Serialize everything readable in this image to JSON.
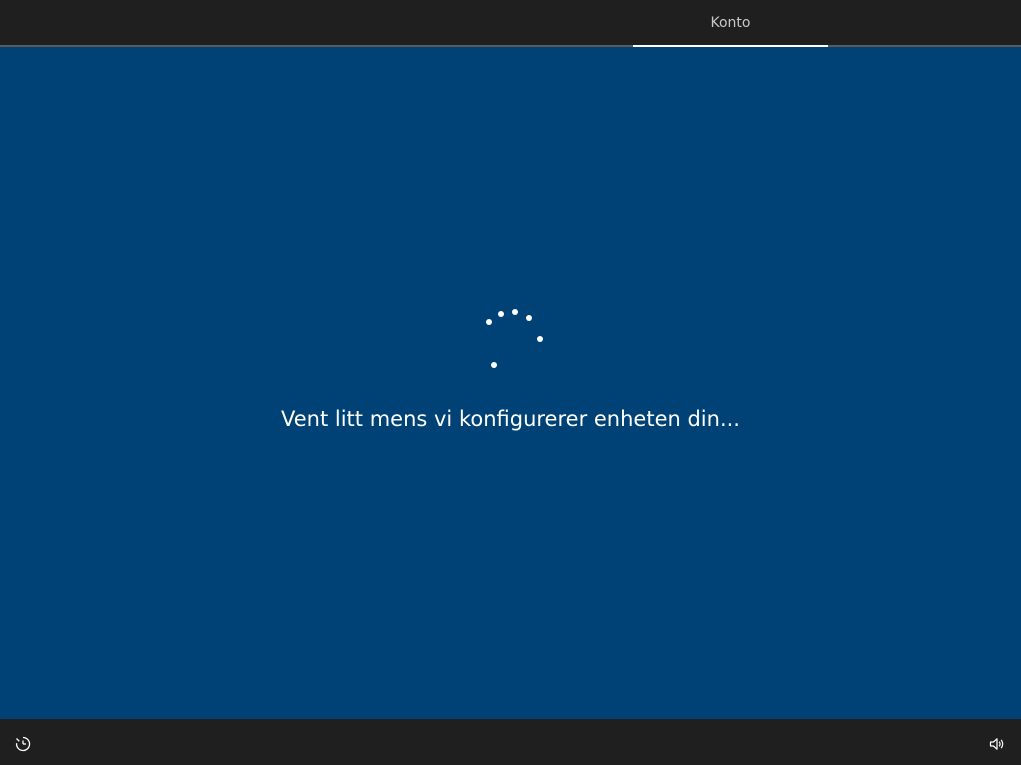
{
  "header": {
    "active_tab_label": "Konto"
  },
  "main": {
    "status_message": "Vent litt mens vi konfigurerer enheten din..."
  },
  "footer": {
    "left_icon": "ease-of-access-icon",
    "right_icon": "volume-icon"
  },
  "colors": {
    "background": "#004275",
    "bars": "#1f1f1f",
    "text": "#ffffff"
  }
}
